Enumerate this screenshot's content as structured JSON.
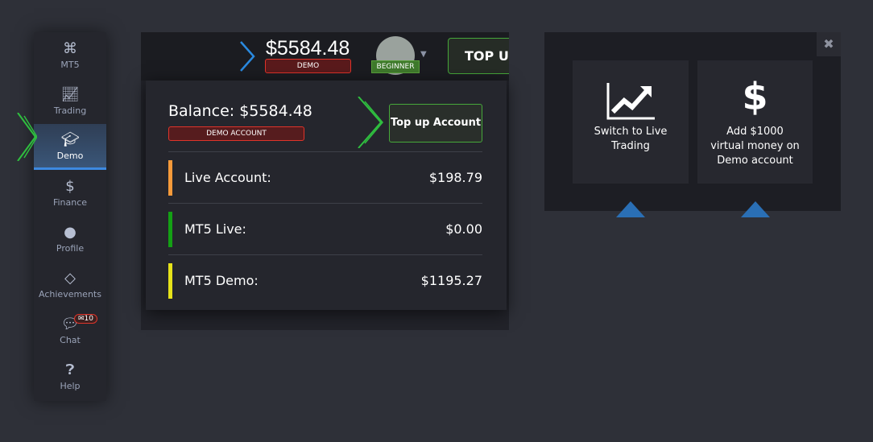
{
  "sidebar": {
    "items": [
      {
        "label": "MT5",
        "icon": "mt5-icon"
      },
      {
        "label": "Trading",
        "icon": "chart-icon"
      },
      {
        "label": "Demo",
        "icon": "graduation-cap-icon",
        "active": true
      },
      {
        "label": "Finance",
        "icon": "dollar-icon"
      },
      {
        "label": "Profile",
        "icon": "user-icon"
      },
      {
        "label": "Achievements",
        "icon": "diamond-icon"
      },
      {
        "label": "Chat",
        "icon": "chat-icon",
        "badge": "✉10"
      },
      {
        "label": "Help",
        "icon": "help-icon"
      }
    ]
  },
  "topbar": {
    "balance": "$5584.48",
    "account_tag": "DEMO",
    "level": "BEGINNER",
    "topup": "TOP UP"
  },
  "panel": {
    "title": "Balance: $5584.48",
    "tag": "DEMO ACCOUNT",
    "topup_button": "Top up Account",
    "accounts": [
      {
        "label": "Live Account:",
        "value": "$198.79",
        "color": "#f59a3a"
      },
      {
        "label": "MT5 Live:",
        "value": "$0.00",
        "color": "#14a014"
      },
      {
        "label": "MT5 Demo:",
        "value": "$1195.27",
        "color": "#e6e21a"
      }
    ]
  },
  "promo": {
    "cards": [
      {
        "label": "Switch to Live Trading",
        "icon": "trending-up-icon"
      },
      {
        "label": "Add $1000 virtual money on Demo account",
        "icon": "dollar-icon"
      }
    ]
  },
  "colors": {
    "accent_green": "#46a83a",
    "demo_red": "#e0342a",
    "active_blue": "#3d8ae0"
  }
}
